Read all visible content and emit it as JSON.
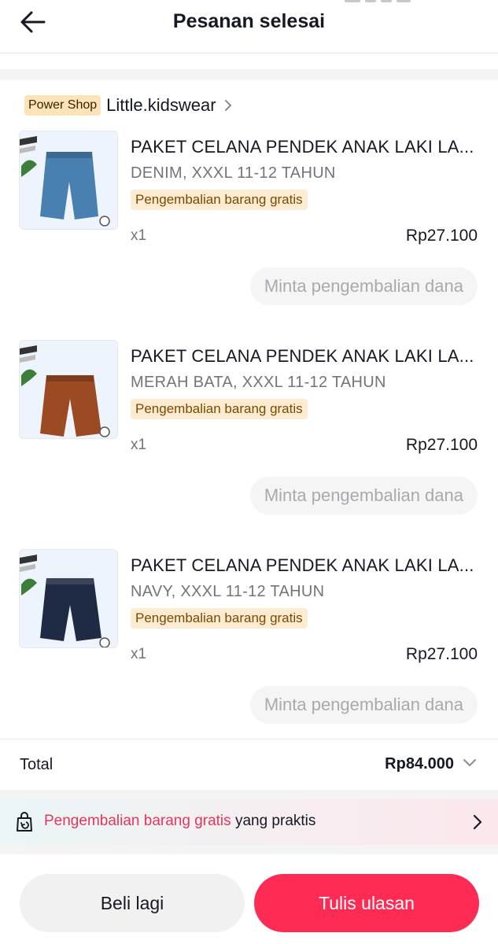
{
  "header": {
    "title": "Pesanan selesai"
  },
  "shop": {
    "badge": "Power Shop",
    "name": "Little.kidswear"
  },
  "items": [
    {
      "name": "PAKET CELANA PENDEK ANAK LAKI LA...",
      "variant": "DENIM, XXXL 11-12 TAHUN",
      "tag": "Pengembalian barang gratis",
      "qty": "x1",
      "price": "Rp27.100",
      "refund_label": "Minta pengembalian dana",
      "shorts_color": "#4a7fb1"
    },
    {
      "name": "PAKET CELANA PENDEK ANAK LAKI LA...",
      "variant": "MERAH BATA, XXXL 11-12 TAHUN",
      "tag": "Pengembalian barang gratis",
      "qty": "x1",
      "price": "Rp27.100",
      "refund_label": "Minta pengembalian dana",
      "shorts_color": "#9c4a24"
    },
    {
      "name": "PAKET CELANA PENDEK ANAK LAKI LA...",
      "variant": "NAVY, XXXL 11-12 TAHUN",
      "tag": "Pengembalian barang gratis",
      "qty": "x1",
      "price": "Rp27.100",
      "refund_label": "Minta pengembalian dana",
      "shorts_color": "#1f2a44"
    }
  ],
  "total": {
    "label": "Total",
    "value": "Rp84.000"
  },
  "promo": {
    "highlight": "Pengembalian barang gratis",
    "rest": " yang praktis"
  },
  "actions": {
    "buy_again": "Beli lagi",
    "write_review": "Tulis ulasan"
  },
  "colors": {
    "accent": "#fe2c55",
    "promo_highlight": "#e8345a",
    "badge_bg": "#fde3b8"
  }
}
